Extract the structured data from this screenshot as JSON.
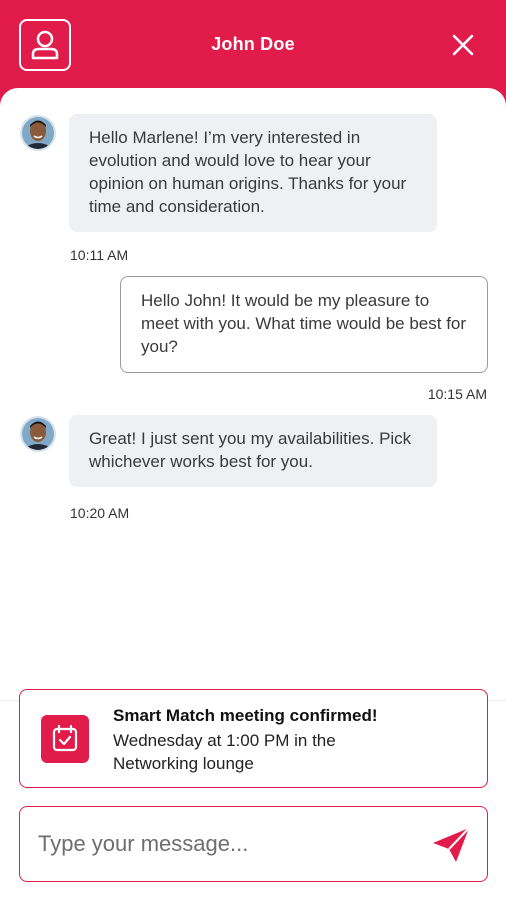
{
  "header": {
    "title": "John Doe",
    "background_color": "#e21c4a",
    "left_icon": "user-profile-icon",
    "right_icon": "close-icon"
  },
  "messages": [
    {
      "direction": "incoming",
      "avatar": "avatar-photo",
      "text": "Hello Marlene! I’m very interested in evolution and would love to hear your opinion on human origins. Thanks for your time and consideration.",
      "time": "10:11 AM"
    },
    {
      "direction": "outgoing",
      "text": "Hello John! It would be my pleasure to meet with you. What time would be best for you?",
      "time": "10:15 AM"
    },
    {
      "direction": "incoming",
      "avatar": "avatar-photo",
      "text": "Great! I just sent you my availabilities. Pick whichever works best for you.",
      "time": "10:20 AM"
    }
  ],
  "meeting": {
    "icon": "calendar-check-icon",
    "title": "Smart Match meeting confirmed!",
    "detail": "Wednesday at 1:00 PM in the Networking lounge"
  },
  "composer": {
    "placeholder": "Type your message...",
    "value": "",
    "send_icon": "send-icon"
  }
}
